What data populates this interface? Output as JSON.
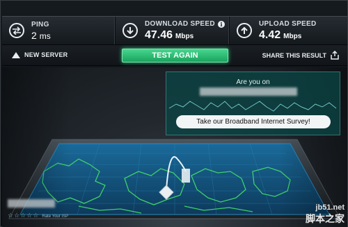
{
  "metrics": {
    "ping": {
      "label": "PING",
      "value": "2",
      "unit": "ms",
      "icon": "ping-arrows-icon"
    },
    "download": {
      "label": "DOWNLOAD SPEED",
      "value": "47.46",
      "unit": "Mbps",
      "icon": "download-arrow-icon",
      "info": "i"
    },
    "upload": {
      "label": "UPLOAD SPEED",
      "value": "4.42",
      "unit": "Mbps",
      "icon": "upload-arrow-icon"
    }
  },
  "actions": {
    "new_server": "NEW SERVER",
    "test_again": "TEST AGAIN",
    "share": "SHARE THIS RESULT"
  },
  "survey": {
    "title": "Are you on",
    "button": "Take our Broadband Internet Survey!"
  },
  "isp": {
    "rate_label": "Rate Your ISP",
    "stars": [
      "☆",
      "☆",
      "☆",
      "☆",
      "☆"
    ]
  },
  "watermark": {
    "site": "jb51.net",
    "name": "脚本之家"
  },
  "colors": {
    "accent_green": "#2ec77a",
    "map_cyan": "#3aa8d8",
    "map_green": "#3fd06a"
  }
}
